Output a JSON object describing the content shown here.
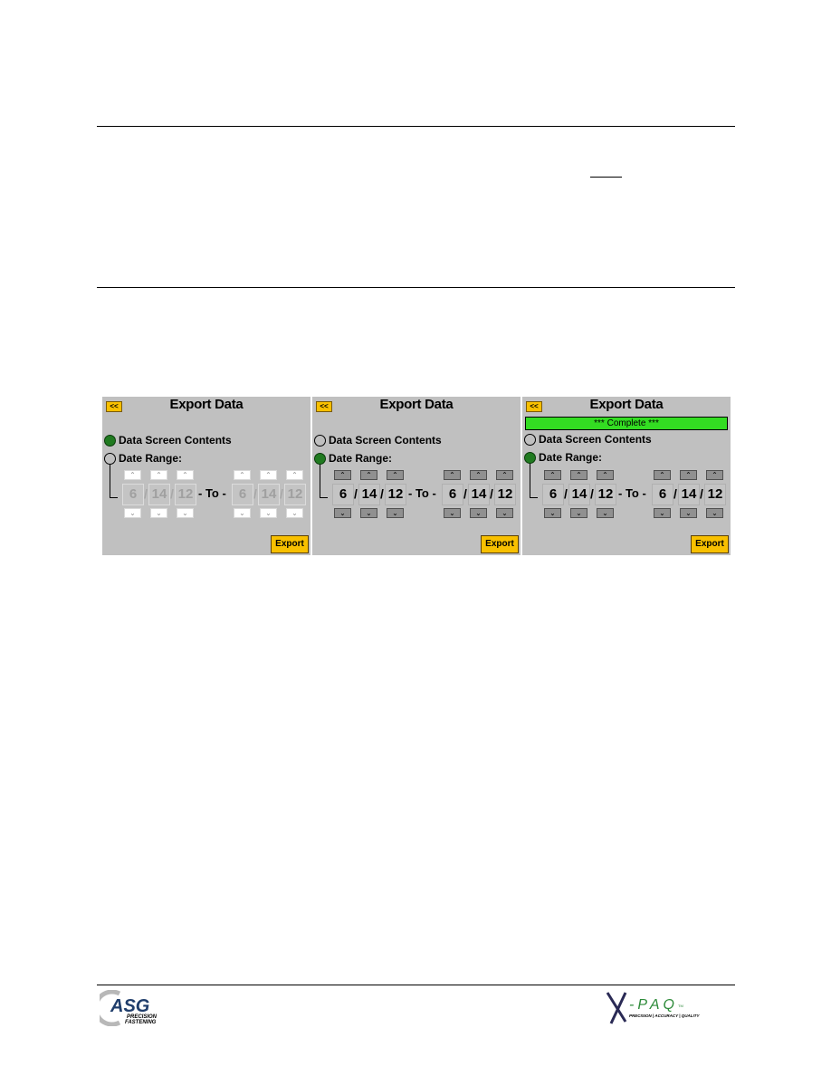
{
  "document": {
    "panels": [
      {
        "title": "Export Data",
        "back_label": "<<",
        "status": null,
        "options": [
          {
            "label": "Data Screen Contents",
            "selected": true
          },
          {
            "label": "Date Range:",
            "selected": false
          }
        ],
        "date_enabled": false,
        "from": {
          "month": "6",
          "day": "14",
          "year": "12"
        },
        "to": {
          "month": "6",
          "day": "14",
          "year": "12"
        },
        "to_label": "- To -",
        "separator": "/",
        "up_glyph": "⌃",
        "down_glyph": "⌄",
        "export_label": "Export"
      },
      {
        "title": "Export Data",
        "back_label": "<<",
        "status": null,
        "options": [
          {
            "label": "Data Screen Contents",
            "selected": false
          },
          {
            "label": "Date Range:",
            "selected": true
          }
        ],
        "date_enabled": true,
        "from": {
          "month": "6",
          "day": "14",
          "year": "12"
        },
        "to": {
          "month": "6",
          "day": "14",
          "year": "12"
        },
        "to_label": "- To -",
        "separator": "/",
        "up_glyph": "⌃",
        "down_glyph": "⌄",
        "export_label": "Export"
      },
      {
        "title": "Export Data",
        "back_label": "<<",
        "status": "*** Complete ***",
        "options": [
          {
            "label": "Data Screen Contents",
            "selected": false
          },
          {
            "label": "Date Range:",
            "selected": true
          }
        ],
        "date_enabled": true,
        "from": {
          "month": "6",
          "day": "14",
          "year": "12"
        },
        "to": {
          "month": "6",
          "day": "14",
          "year": "12"
        },
        "to_label": "- To -",
        "separator": "/",
        "up_glyph": "⌃",
        "down_glyph": "⌄",
        "export_label": "Export"
      }
    ],
    "footer": {
      "left_logo": {
        "name": "ASG",
        "line1": "PRECISION",
        "line2": "FASTENING"
      },
      "right_logo": {
        "name": "X-PAQ",
        "tm": "TM",
        "tagline": "PRECISION | ACCURACY | QUALITY"
      }
    },
    "colors": {
      "panel_bg": "#c0c0c0",
      "button_yellow": "#f8c000",
      "radio_selected": "#207a20",
      "status_green": "#33dd22",
      "asg_blue": "#1f3d6b",
      "xpaq_green": "#2e8b3a"
    }
  }
}
